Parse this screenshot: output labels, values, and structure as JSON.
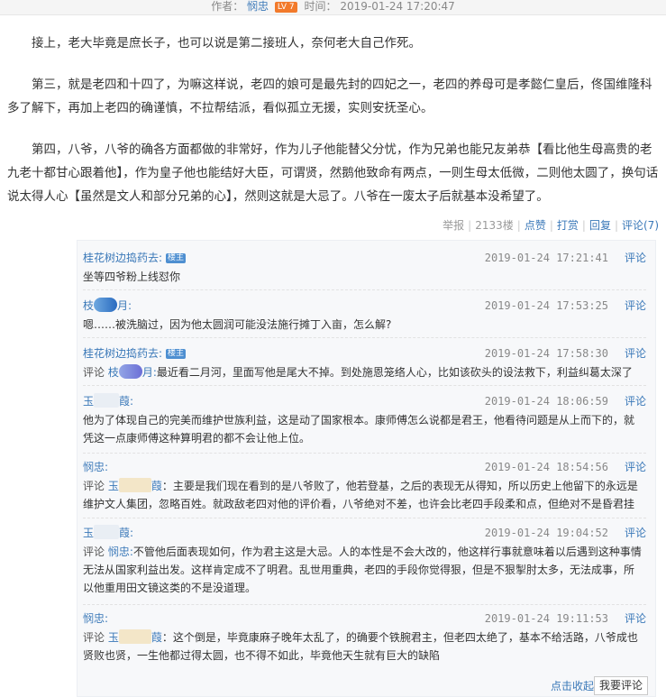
{
  "header": {
    "author_label": "作者：",
    "author": "悯忠",
    "level": "LV 7",
    "time_label": "时间：",
    "time": "2019-01-24 17:20:47"
  },
  "post": {
    "paragraphs": [
      "接上，老大毕竟是庶长子，也可以说是第二接班人，奈何老大自己作死。",
      "第三，就是老四和十四了，为嘛这样说，老四的娘可是最先封的四妃之一，老四的养母可是孝懿仁皇后，佟国维隆科多了解下，再加上老四的确谨慎，不拉帮结派，看似孤立无援，实则安抚圣心。",
      "第四，八爷，八爷的确各方面都做的非常好，作为儿子他能替父分忧，作为兄弟也能兄友弟恭【看比他生母高贵的老九老十都甘心跟着他】，作为皇子他也能结好大臣，可谓贤，然鹅他致命有两点，一则生母太低微，二则他太圆了，换句话说太得人心【虽然是文人和部分兄弟的心】，然则这就是大忌了。八爷在一废太子后就基本没希望了。"
    ]
  },
  "post_actions": {
    "report": "举报",
    "floor": "2133楼",
    "like": "点赞",
    "tip": "打赏",
    "reply": "回复",
    "comment": "评论(7)"
  },
  "comments": [
    {
      "name": "桂花树边捣药去:",
      "tag": "楼主",
      "time": "2019-01-24 17:21:41",
      "action": "评论",
      "text": "坐等四爷粉上线怼你"
    },
    {
      "name_a": "枝",
      "name_b": "月:",
      "time": "2019-01-24 17:53:25",
      "action": "评论",
      "text": "嗯……被洗脑过，因为他太圆润可能没法施行摊丁入亩，怎么解?"
    },
    {
      "name": "桂花树边捣药去:",
      "tag": "楼主",
      "time": "2019-01-24 17:58:30",
      "action": "评论",
      "prefix": "评论",
      "ref_a": "枝",
      "ref_b": "月:",
      "text": "最近看二月河，里面写他是尾大不掉。到处施恩笼络人心，比如该砍头的设法救下，利益纠葛太深了"
    },
    {
      "name_a": "玉",
      "name_b": "葭:",
      "time": "2019-01-24 18:06:59",
      "action": "评论",
      "text": "他为了体现自己的完美而维护世族利益，这是动了国家根本。康师傅怎么说都是君王，他看待问题是从上而下的，就凭这一点康师傅这种算明君的都不会让他上位。"
    },
    {
      "name": "悯忠:",
      "time": "2019-01-24 18:54:56",
      "action": "评论",
      "prefix": "评论",
      "ref_a": "玉",
      "ref_b": "葭",
      "text": "：主要是我们现在看到的是八爷败了，他若登基，之后的表现无从得知，所以历史上他留下的永远是维护文人集团，忽略百姓。就政敌老四对他的评价看，八爷绝对不差，也许会比老四手段柔和点，但绝对不是昏君挂"
    },
    {
      "name_a": "玉",
      "name_b": "葭:",
      "time": "2019-01-24 19:04:52",
      "action": "评论",
      "prefix": "评论",
      "ref": "悯忠:",
      "text": "不管他后面表现如何，作为君主这是大忌。人的本性是不会大改的，他这样行事就意味着以后遇到这种事情无法从国家利益出发。这样肯定成不了明君。乱世用重典，老四的手段你觉得狠，但是不狠掣肘太多，无法成事，所以他重用田文镜这类的不是没道理。"
    },
    {
      "name": "悯忠:",
      "time": "2019-01-24 19:11:53",
      "action": "评论",
      "prefix": "评论",
      "ref_a": "玉",
      "ref_b": "葭",
      "text": "：这个倒是，毕竟康麻子晚年太乱了，的确要个铁腕君主，但老四太绝了，基本不给活路，八爷成也贤败也贤，一生他都过得太圆，也不得不如此，毕竟他天生就有巨大的缺陷"
    }
  ],
  "footer": {
    "collapse": "点击收起",
    "my_comment": "我要评论"
  }
}
